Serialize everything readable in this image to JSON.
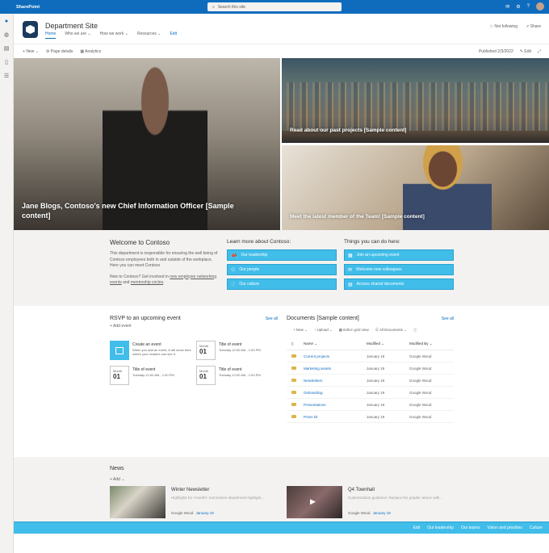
{
  "appbar": {
    "brand": "SharePoint",
    "search_placeholder": "Search this site"
  },
  "site": {
    "title": "Department Site",
    "nav": [
      {
        "label": "Home"
      },
      {
        "label": "Who we are"
      },
      {
        "label": "How we work"
      },
      {
        "label": "Resources"
      },
      {
        "label": "Edit"
      }
    ],
    "follow_label": "Not following",
    "share_label": "Share"
  },
  "cmd": {
    "new": "New",
    "page_details": "Page details",
    "analytics": "Analytics",
    "published": "Published 2/3/2022",
    "edit": "Edit"
  },
  "hero": {
    "main": "Jane Blogs, Contoso's new Chief Information Officer [Sample content]",
    "top_right": "Read about our past projects [Sample content]",
    "bottom_right": "Meet the latest member of the Team! [Sample content]"
  },
  "welcome": {
    "title": "Welcome to Contoso",
    "body": "This department is responsible for ensuring the well being of Contoso employees both in and outside of the workplace. Here you can meet Contoso",
    "body2_prefix": "New to Contoso? Get involved in ",
    "link1": "new employee networking events",
    "body2_mid": " and ",
    "link2": "mentorship circles",
    "body2_suffix": "."
  },
  "learn": {
    "title": "Learn more about Contoso:",
    "items": [
      {
        "label": "Our leadership"
      },
      {
        "label": "Our people"
      },
      {
        "label": "Our culture"
      }
    ]
  },
  "things": {
    "title": "Things you can do here:",
    "items": [
      {
        "label": "Join an upcoming event"
      },
      {
        "label": "Welcome new colleagues"
      },
      {
        "label": "Access shared documents"
      }
    ]
  },
  "rsvp": {
    "title": "RSVP to an upcoming event",
    "see_all": "See all",
    "add": "Add event",
    "events": [
      {
        "month": "",
        "day": "",
        "title": "Create an event",
        "sub": "When you add an event, it will show here where your readers can see it."
      },
      {
        "month": "Month",
        "day": "01",
        "title": "Title of event",
        "sub": "Tuesday 12:00 AM - 1:00 PM"
      },
      {
        "month": "Month",
        "day": "01",
        "title": "Title of event",
        "sub": "Tuesday 12:00 AM - 1:00 PM"
      },
      {
        "month": "Month",
        "day": "01",
        "title": "Title of event",
        "sub": "Tuesday 12:00 AM - 1:00 PM"
      }
    ]
  },
  "docs": {
    "title": "Documents [Sample content]",
    "see_all": "See all",
    "cmd": {
      "new": "New",
      "upload": "Upload",
      "grid": "Edit in grid view",
      "view": "All Documents"
    },
    "headers": {
      "name": "Name",
      "modified": "Modified",
      "modified_by": "Modified By"
    },
    "rows": [
      {
        "name": "Current projects",
        "modified": "January 19",
        "by": "Google Wood"
      },
      {
        "name": "Marketing assets",
        "modified": "January 19",
        "by": "Google Wood"
      },
      {
        "name": "Newsletters",
        "modified": "January 19",
        "by": "Google Wood"
      },
      {
        "name": "Onboarding",
        "modified": "January 19",
        "by": "Google Wood"
      },
      {
        "name": "Presentations",
        "modified": "January 19",
        "by": "Google Wood"
      },
      {
        "name": "Press kit",
        "modified": "January 19",
        "by": "Google Wood"
      }
    ]
  },
  "news": {
    "title": "News",
    "add": "Add",
    "items": [
      {
        "title": "Winter Newsletter",
        "summary": "Highlights for <month> Summarize department highlight...",
        "author": "Google Wood",
        "date": "January 19"
      },
      {
        "title": "Q4 Townhall",
        "summary": "Customization guidance: Replace the graphic above with...",
        "author": "Google Wood",
        "date": "January 19"
      }
    ]
  },
  "footer": {
    "links": [
      {
        "label": "Edit"
      },
      {
        "label": "Our leadership"
      },
      {
        "label": "Our teams"
      },
      {
        "label": "Vision and priorities"
      },
      {
        "label": "Culture"
      }
    ]
  },
  "colors": {
    "accent": "#41bde9",
    "brand": "#0f6cbd",
    "logo": "#1b3a5c"
  }
}
